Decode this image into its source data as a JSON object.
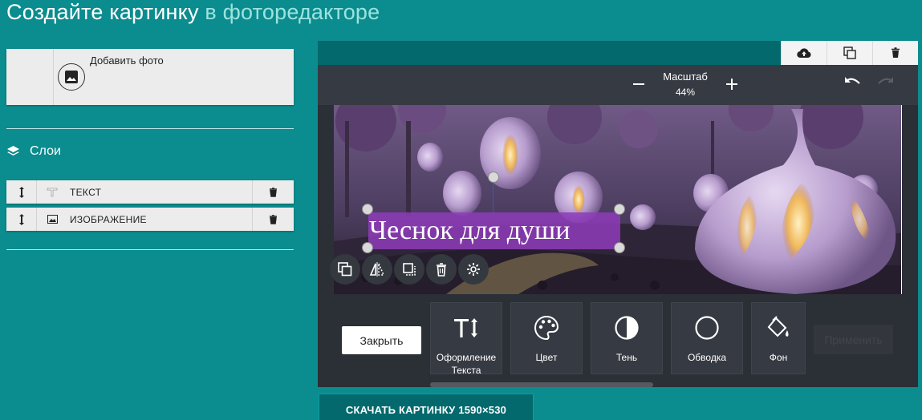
{
  "page": {
    "title_main": "Создайте картинку",
    "title_accent": "в фоторедакторе"
  },
  "left_panel": {
    "add_photo_label": "Добавить фото",
    "layers_title": "Слои",
    "layers": [
      {
        "name": "ТЕКСТ",
        "type_icon": "text-layer-icon"
      },
      {
        "name": "ИЗОБРАЖЕНИЕ",
        "type_icon": "image-layer-icon"
      }
    ]
  },
  "editor": {
    "top_actions": [
      "upload-cloud-icon",
      "duplicate-icon",
      "trash-icon"
    ],
    "zoom_label": "Масштаб",
    "zoom_value": "44%",
    "canvas_text": "Чеснок для души",
    "canvas_image": "garlic fantasy landscape",
    "text_tools": [
      "duplicate-icon",
      "flip-icon",
      "crop-icon",
      "trash-icon",
      "settings-icon"
    ],
    "bottom": {
      "close_label": "Закрыть",
      "tiles": [
        {
          "label": "Оформление Текста",
          "icon": "text-format-icon"
        },
        {
          "label": "Цвет",
          "icon": "palette-icon"
        },
        {
          "label": "Тень",
          "icon": "shadow-icon"
        },
        {
          "label": "Обводка",
          "icon": "outline-icon"
        },
        {
          "label": "Фон",
          "icon": "fill-bucket-icon"
        }
      ],
      "apply_label": "Применить"
    }
  },
  "download_label": "СКАЧАТЬ КАРТИНКУ 1590×530",
  "colors": {
    "background": "#0b8c8f",
    "editor_dark": "#2b2f36",
    "teal_dark": "#03696c",
    "text_highlight": "#8e3cba"
  }
}
